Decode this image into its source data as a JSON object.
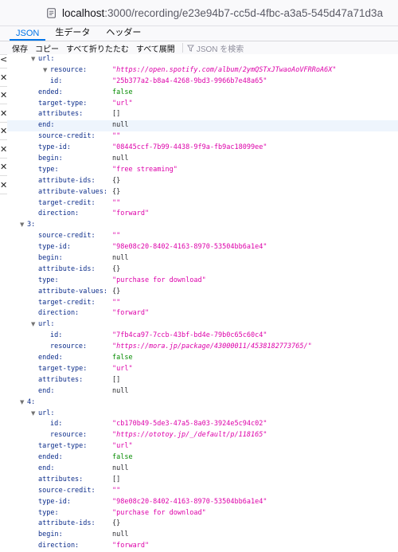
{
  "address": {
    "host": "localhost",
    "path": ":3000/recording/e23e94b7-cc5d-4fbc-a3a5-545d47a71d3a"
  },
  "tabs": [
    {
      "label": "JSON"
    },
    {
      "label": "生データ"
    },
    {
      "label": "ヘッダー"
    }
  ],
  "toolbar": {
    "save": "保存",
    "copy": "コピー",
    "collapse_all": "すべて折りたたむ",
    "expand_all": "すべて展開",
    "filter_placeholder": "JSON を検索"
  },
  "side_closes": [
    "<",
    "✕",
    "✕",
    "✕",
    "✕",
    "✕",
    "✕",
    "✕"
  ],
  "rows": [
    {
      "indent": 1,
      "toggle": true,
      "key": "url:",
      "val": "",
      "t": ""
    },
    {
      "indent": 2,
      "toggle": true,
      "key": "resource:",
      "val": "\"https://open.spotify.com/album/2ymQSTxJTwaoAoVFRRoA6X\"",
      "t": "s",
      "italic": true
    },
    {
      "indent": 3,
      "key": "id:",
      "val": "\"25b377a2-b8a4-4268-9bd3-9966b7e48a65\"",
      "t": "s"
    },
    {
      "indent": 1,
      "key": "ended:",
      "val": "false",
      "t": "b"
    },
    {
      "indent": 1,
      "key": "target-type:",
      "val": "\"url\"",
      "t": "s"
    },
    {
      "indent": 1,
      "key": "attributes:",
      "val": "[]",
      "t": "n"
    },
    {
      "indent": 1,
      "key": "end:",
      "val": "null",
      "t": "n",
      "hl": true
    },
    {
      "indent": 1,
      "key": "source-credit:",
      "val": "\"\"",
      "t": "s"
    },
    {
      "indent": 1,
      "key": "type-id:",
      "val": "\"08445ccf-7b99-4438-9f9a-fb9ac18099ee\"",
      "t": "s"
    },
    {
      "indent": 1,
      "key": "begin:",
      "val": "null",
      "t": "n"
    },
    {
      "indent": 1,
      "key": "type:",
      "val": "\"free streaming\"",
      "t": "s"
    },
    {
      "indent": 1,
      "key": "attribute-ids:",
      "val": "{}",
      "t": "n"
    },
    {
      "indent": 1,
      "key": "attribute-values:",
      "val": "{}",
      "t": "n"
    },
    {
      "indent": 1,
      "key": "target-credit:",
      "val": "\"\"",
      "t": "s"
    },
    {
      "indent": 1,
      "key": "direction:",
      "val": "\"forward\"",
      "t": "s"
    },
    {
      "indent": 0,
      "toggle": true,
      "key": "3:",
      "val": "",
      "t": ""
    },
    {
      "indent": 1,
      "key": "source-credit:",
      "val": "\"\"",
      "t": "s"
    },
    {
      "indent": 1,
      "key": "type-id:",
      "val": "\"98e08c20-8402-4163-8970-53504bb6a1e4\"",
      "t": "s"
    },
    {
      "indent": 1,
      "key": "begin:",
      "val": "null",
      "t": "n"
    },
    {
      "indent": 1,
      "key": "attribute-ids:",
      "val": "{}",
      "t": "n"
    },
    {
      "indent": 1,
      "key": "type:",
      "val": "\"purchase for download\"",
      "t": "s"
    },
    {
      "indent": 1,
      "key": "attribute-values:",
      "val": "{}",
      "t": "n"
    },
    {
      "indent": 1,
      "key": "target-credit:",
      "val": "\"\"",
      "t": "s"
    },
    {
      "indent": 1,
      "key": "direction:",
      "val": "\"forward\"",
      "t": "s"
    },
    {
      "indent": 1,
      "toggle": true,
      "key": "url:",
      "val": "",
      "t": ""
    },
    {
      "indent": 2,
      "key": "id:",
      "val": "\"7fb4ca97-7ccb-43bf-bd4e-79b0c65c60c4\"",
      "t": "s"
    },
    {
      "indent": 2,
      "key": "resource:",
      "val": "\"https://mora.jp/package/43000011/4538182773765/\"",
      "t": "s",
      "italic": true
    },
    {
      "indent": 1,
      "key": "ended:",
      "val": "false",
      "t": "b"
    },
    {
      "indent": 1,
      "key": "target-type:",
      "val": "\"url\"",
      "t": "s"
    },
    {
      "indent": 1,
      "key": "attributes:",
      "val": "[]",
      "t": "n"
    },
    {
      "indent": 1,
      "key": "end:",
      "val": "null",
      "t": "n"
    },
    {
      "indent": 0,
      "toggle": true,
      "key": "4:",
      "val": "",
      "t": ""
    },
    {
      "indent": 1,
      "toggle": true,
      "key": "url:",
      "val": "",
      "t": ""
    },
    {
      "indent": 2,
      "key": "id:",
      "val": "\"cb170b49-5de3-47a5-8a03-3924e5c94c02\"",
      "t": "s"
    },
    {
      "indent": 2,
      "key": "resource:",
      "val": "\"https://ototoy.jp/_/default/p/118165\"",
      "t": "s",
      "italic": true
    },
    {
      "indent": 1,
      "key": "target-type:",
      "val": "\"url\"",
      "t": "s"
    },
    {
      "indent": 1,
      "key": "ended:",
      "val": "false",
      "t": "b"
    },
    {
      "indent": 1,
      "key": "end:",
      "val": "null",
      "t": "n"
    },
    {
      "indent": 1,
      "key": "attributes:",
      "val": "[]",
      "t": "n"
    },
    {
      "indent": 1,
      "key": "source-credit:",
      "val": "\"\"",
      "t": "s"
    },
    {
      "indent": 1,
      "key": "type-id:",
      "val": "\"98e08c20-8402-4163-8970-53504bb6a1e4\"",
      "t": "s"
    },
    {
      "indent": 1,
      "key": "type:",
      "val": "\"purchase for download\"",
      "t": "s"
    },
    {
      "indent": 1,
      "key": "attribute-ids:",
      "val": "{}",
      "t": "n"
    },
    {
      "indent": 1,
      "key": "begin:",
      "val": "null",
      "t": "n"
    },
    {
      "indent": 1,
      "key": "direction:",
      "val": "\"forward\"",
      "t": "s"
    }
  ]
}
